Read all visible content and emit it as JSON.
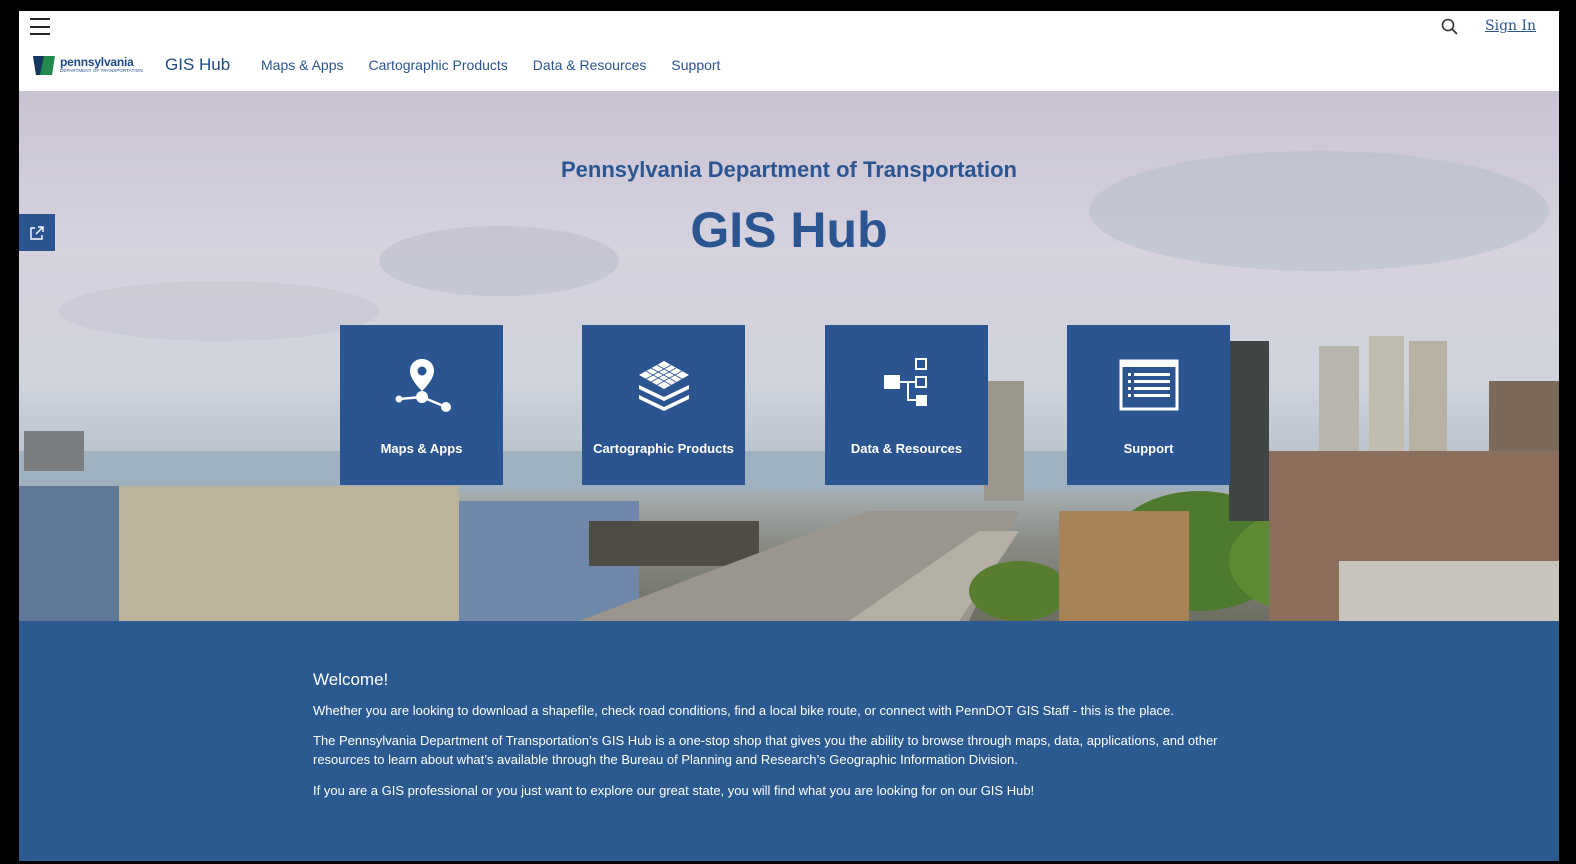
{
  "header": {
    "sign_in": "Sign In",
    "logo_line1": "pennsylvania",
    "logo_line2": "DEPARTMENT OF TRANSPORTATION",
    "site_title": "GIS Hub"
  },
  "nav": {
    "items": [
      "Maps & Apps",
      "Cartographic Products",
      "Data & Resources",
      "Support"
    ]
  },
  "hero": {
    "subtitle": "Pennsylvania Department of Transportation",
    "title": "GIS Hub",
    "tiles": [
      {
        "label": "Maps & Apps",
        "icon": "map-pin-network-icon"
      },
      {
        "label": "Cartographic Products",
        "icon": "layers-icon"
      },
      {
        "label": "Data & Resources",
        "icon": "data-tree-icon"
      },
      {
        "label": "Support",
        "icon": "document-list-icon"
      }
    ]
  },
  "welcome": {
    "heading": "Welcome!",
    "paragraphs": [
      "Whether you are looking to download a shapefile, check road conditions, find a local bike route, or connect with PennDOT GIS Staff - this is the place.",
      "The Pennsylvania Department of Transportation’s GIS Hub is a one-stop shop that gives you the ability to browse through maps, data, applications, and other resources to learn about what’s available through the Bureau of Planning and Research’s Geographic Information Division.",
      "If you are a GIS professional or you just want to explore our great state, you will find what you are looking for on our GIS Hub!"
    ]
  },
  "colors": {
    "brand_blue": "#2b5591",
    "welcome_bg": "#2b5a90",
    "logo_green": "#1f8a4c"
  }
}
